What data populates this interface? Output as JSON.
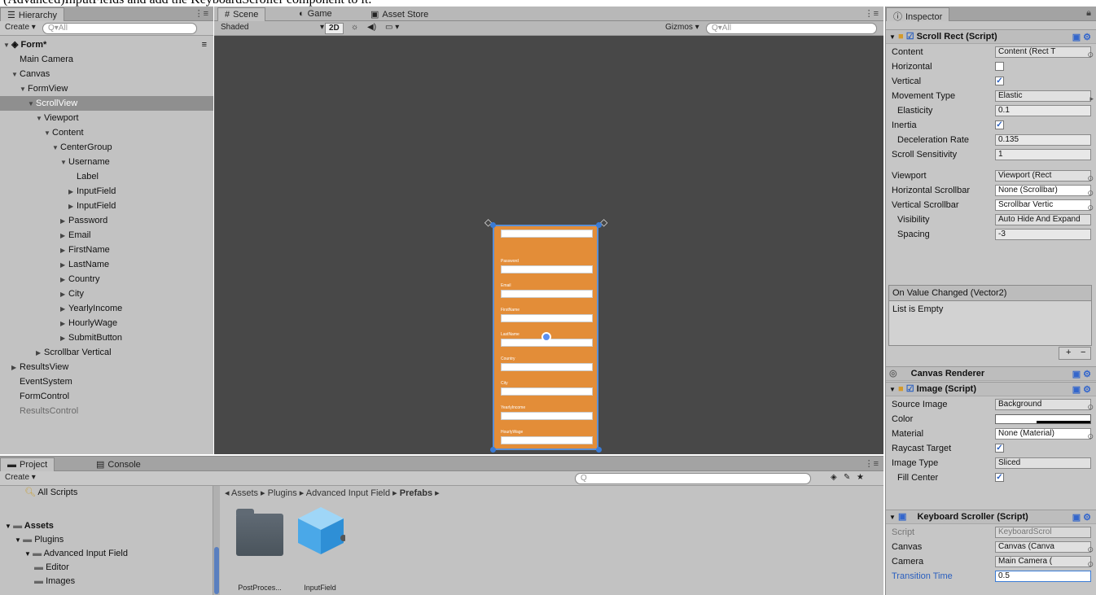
{
  "top_strip_text": "(Advanced)InputFields and add the KeyboardScroller component to it.",
  "hierarchy": {
    "tab": "Hierarchy",
    "create": "Create ▾",
    "search_placeholder": "Q▾All",
    "rows": [
      {
        "label": "Form*",
        "indent": 0,
        "arrow": "▼",
        "bold": true
      },
      {
        "label": "Main Camera",
        "indent": 1,
        "arrow": ""
      },
      {
        "label": "Canvas",
        "indent": 1,
        "arrow": "▼"
      },
      {
        "label": "FormView",
        "indent": 2,
        "arrow": "▼"
      },
      {
        "label": "ScrollView",
        "indent": 3,
        "arrow": "▼",
        "selected": true
      },
      {
        "label": "Viewport",
        "indent": 4,
        "arrow": "▼"
      },
      {
        "label": "Content",
        "indent": 5,
        "arrow": "▼"
      },
      {
        "label": "CenterGroup",
        "indent": 6,
        "arrow": "▼"
      },
      {
        "label": "Username",
        "indent": 7,
        "arrow": "▼"
      },
      {
        "label": "Label",
        "indent": 8,
        "arrow": ""
      },
      {
        "label": "InputField",
        "indent": 8,
        "arrow": "▶"
      },
      {
        "label": "InputField",
        "indent": 8,
        "arrow": "▶"
      },
      {
        "label": "Password",
        "indent": 7,
        "arrow": "▶"
      },
      {
        "label": "Email",
        "indent": 7,
        "arrow": "▶"
      },
      {
        "label": "FirstName",
        "indent": 7,
        "arrow": "▶"
      },
      {
        "label": "LastName",
        "indent": 7,
        "arrow": "▶"
      },
      {
        "label": "Country",
        "indent": 7,
        "arrow": "▶"
      },
      {
        "label": "City",
        "indent": 7,
        "arrow": "▶"
      },
      {
        "label": "YearlyIncome",
        "indent": 7,
        "arrow": "▶"
      },
      {
        "label": "HourlyWage",
        "indent": 7,
        "arrow": "▶"
      },
      {
        "label": "SubmitButton",
        "indent": 7,
        "arrow": "▶"
      },
      {
        "label": "Scrollbar Vertical",
        "indent": 4,
        "arrow": "▶"
      },
      {
        "label": "ResultsView",
        "indent": 1,
        "arrow": "▶"
      },
      {
        "label": "EventSystem",
        "indent": 1,
        "arrow": ""
      },
      {
        "label": "FormControl",
        "indent": 1,
        "arrow": ""
      },
      {
        "label": "ResultsControl",
        "indent": 1,
        "arrow": "",
        "grey": true
      }
    ]
  },
  "scene": {
    "tabs": [
      "Scene",
      "Game",
      "Asset Store"
    ],
    "shaded": "Shaded",
    "mode_2d": "2D",
    "gizmos": "Gizmos ▾",
    "search_placeholder": "Q▾All",
    "form_labels": [
      "",
      "Password",
      "Email",
      "FirstName",
      "LastName",
      "Country",
      "City",
      "YearlyIncome",
      "HourlyWage"
    ]
  },
  "inspector": {
    "tab": "Inspector",
    "scroll_rect": {
      "title": "Scroll Rect (Script)",
      "content_label": "Content",
      "content_value": "Content (Rect T",
      "horizontal_label": "Horizontal",
      "vertical_label": "Vertical",
      "movement_label": "Movement Type",
      "movement_value": "Elastic",
      "elasticity_label": "Elasticity",
      "elasticity_value": "0.1",
      "inertia_label": "Inertia",
      "decel_label": "Deceleration Rate",
      "decel_value": "0.135",
      "sensitivity_label": "Scroll Sensitivity",
      "sensitivity_value": "1",
      "viewport_label": "Viewport",
      "viewport_value": "Viewport (Rect",
      "hscroll_label": "Horizontal Scrollbar",
      "hscroll_value": "None (Scrollbar)",
      "vscroll_label": "Vertical Scrollbar",
      "vscroll_value": "Scrollbar Vertic",
      "visibility_label": "Visibility",
      "visibility_value": "Auto Hide And Expand",
      "spacing_label": "Spacing",
      "spacing_value": "-3",
      "event_title": "On Value Changed (Vector2)",
      "event_empty": "List is Empty",
      "plus": "+",
      "minus": "−"
    },
    "canvas_renderer": {
      "title": "Canvas Renderer"
    },
    "image": {
      "title": "Image (Script)",
      "source_label": "Source Image",
      "source_value": "Background",
      "color_label": "Color",
      "material_label": "Material",
      "material_value": "None (Material)",
      "raycast_label": "Raycast Target",
      "type_label": "Image Type",
      "type_value": "Sliced",
      "fill_label": "Fill Center"
    },
    "keyboard_scroller": {
      "title": "Keyboard Scroller (Script)",
      "script_label": "Script",
      "script_value": "KeyboardScrol",
      "canvas_label": "Canvas",
      "canvas_value": "Canvas (Canva",
      "camera_label": "Camera",
      "camera_value": "Main Camera (",
      "transition_label": "Transition Time",
      "transition_value": "0.5"
    }
  },
  "project": {
    "tabs": [
      "Project",
      "Console"
    ],
    "create": "Create ▾",
    "search_placeholder": "Q",
    "tree": [
      {
        "label": "All Scripts",
        "indent": 2
      },
      {
        "label": "Assets",
        "indent": 0,
        "bold": true,
        "arrow": "▼"
      },
      {
        "label": "Plugins",
        "indent": 1,
        "arrow": "▼"
      },
      {
        "label": "Advanced Input Field",
        "indent": 2,
        "arrow": "▼"
      },
      {
        "label": "Editor",
        "indent": 3
      },
      {
        "label": "Images",
        "indent": 3
      }
    ],
    "breadcrumb_parts": [
      "Assets",
      "Plugins",
      "Advanced Input Field"
    ],
    "breadcrumb_last": "Prefabs",
    "assets": [
      "PostProces...",
      "InputField"
    ]
  }
}
